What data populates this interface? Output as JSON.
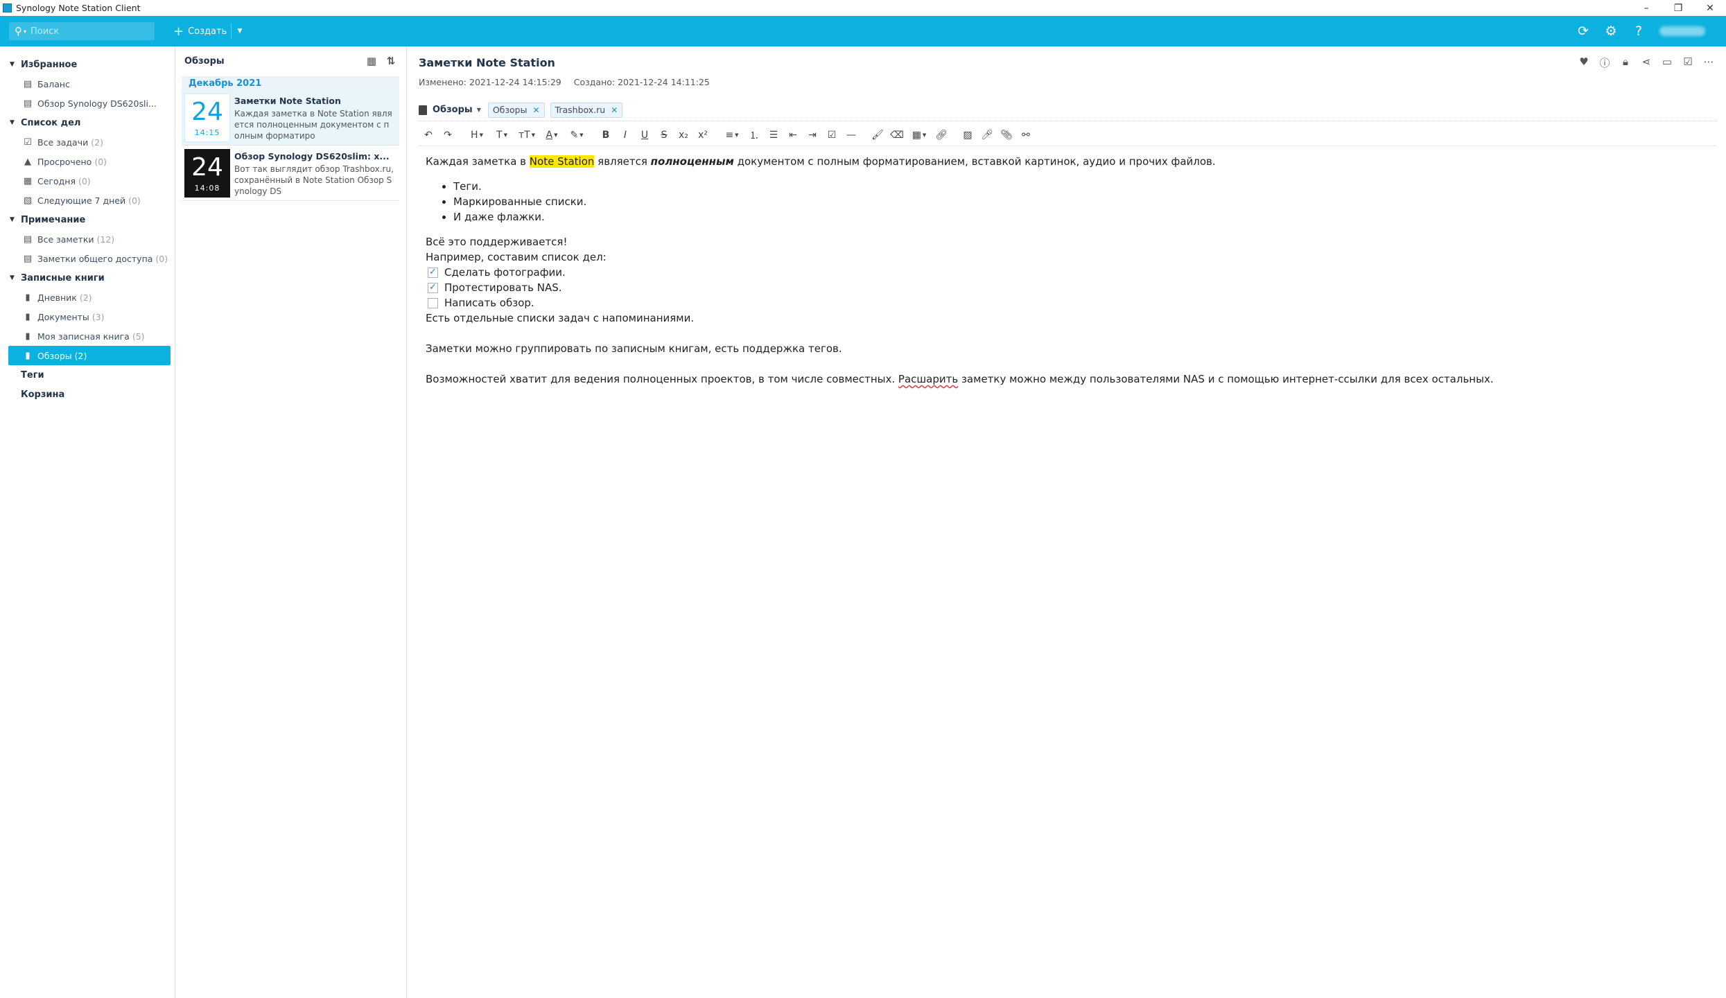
{
  "window": {
    "title": "Synology Note Station Client"
  },
  "topbar": {
    "search_placeholder": "Поиск",
    "create_label": "Создать"
  },
  "sidebar": {
    "sections": [
      {
        "title": "Избранное",
        "items": [
          {
            "label": "Баланс",
            "count": "",
            "icon": "note-icon"
          },
          {
            "label": "Обзор Synology DS620sli...",
            "count": "",
            "icon": "note-icon"
          }
        ]
      },
      {
        "title": "Список дел",
        "items": [
          {
            "label": "Все задачи",
            "count": "(2)",
            "icon": "checkbox-icon"
          },
          {
            "label": "Просрочено",
            "count": "(0)",
            "icon": "warning-icon"
          },
          {
            "label": "Сегодня",
            "count": "(0)",
            "icon": "calendar-icon"
          },
          {
            "label": "Следующие 7 дней",
            "count": "(0)",
            "icon": "calendar-week-icon"
          }
        ]
      },
      {
        "title": "Примечание",
        "items": [
          {
            "label": "Все заметки",
            "count": "(12)",
            "icon": "notes-icon"
          },
          {
            "label": "Заметки общего доступа",
            "count": "(0)",
            "icon": "shared-notes-icon"
          }
        ]
      },
      {
        "title": "Записные книги",
        "items": [
          {
            "label": "Дневник",
            "count": "(2)",
            "icon": "notebook-icon"
          },
          {
            "label": "Документы",
            "count": "(3)",
            "icon": "notebook-icon"
          },
          {
            "label": "Моя записная книга",
            "count": "(5)",
            "icon": "notebook-icon"
          },
          {
            "label": "Обзоры",
            "count": "(2)",
            "icon": "notebook-icon"
          }
        ]
      }
    ],
    "tags_label": "Теги",
    "trash_label": "Корзина"
  },
  "notelist": {
    "title": "Обзоры",
    "month": "Декабрь 2021",
    "notes": [
      {
        "day": "24",
        "time": "14:15",
        "title": "Заметки Note Station",
        "snippet": "Каждая заметка в Note Station является полноценным документом с полным форматиро"
      },
      {
        "day": "24",
        "time": "14:08",
        "title": "Обзор Synology DS620slim: х...",
        "snippet": "Вот так выглядит обзор Trashbox.ru, сохранённый в Note Station Обзор Synology DS"
      }
    ]
  },
  "editor": {
    "title": "Заметки Note Station",
    "modified": "Изменено: 2021-12-24 14:15:29",
    "created": "Создано: 2021-12-24 14:11:25",
    "notebook": "Обзоры",
    "tags": [
      "Обзоры",
      "Trashbox.ru"
    ],
    "body": {
      "p1_a": "Каждая заметка в ",
      "p1_hl": "Note Station",
      "p1_b": " является ",
      "p1_bi": "полноценным",
      "p1_c": " документом с полным форматированием, вставкой картинок, аудио и прочих файлов.",
      "bullets": [
        "Теги.",
        "Маркированные списки.",
        "И даже флажки."
      ],
      "l1": "Всё это поддерживается!",
      "l2": "Например, составим список дел:",
      "checks": [
        {
          "label": "Сделать фотографии.",
          "checked": true
        },
        {
          "label": "Протестировать NAS.",
          "checked": true
        },
        {
          "label": "Написать обзор.",
          "checked": false
        }
      ],
      "l3": "Есть отдельные списки задач с напоминаниями.",
      "p2": "Заметки можно группировать по записным книгам, есть поддержка тегов.",
      "p3_a": "Возможностей хватит для ведения полноценных проектов, в том числе совместных. ",
      "p3_spell": "Расшарить",
      "p3_b": " заметку можно между пользователями NAS и с помощью интернет-ссылки для всех остальных."
    }
  },
  "colors": {
    "accent": "#0cb1df",
    "highlight": "#ffe800"
  }
}
